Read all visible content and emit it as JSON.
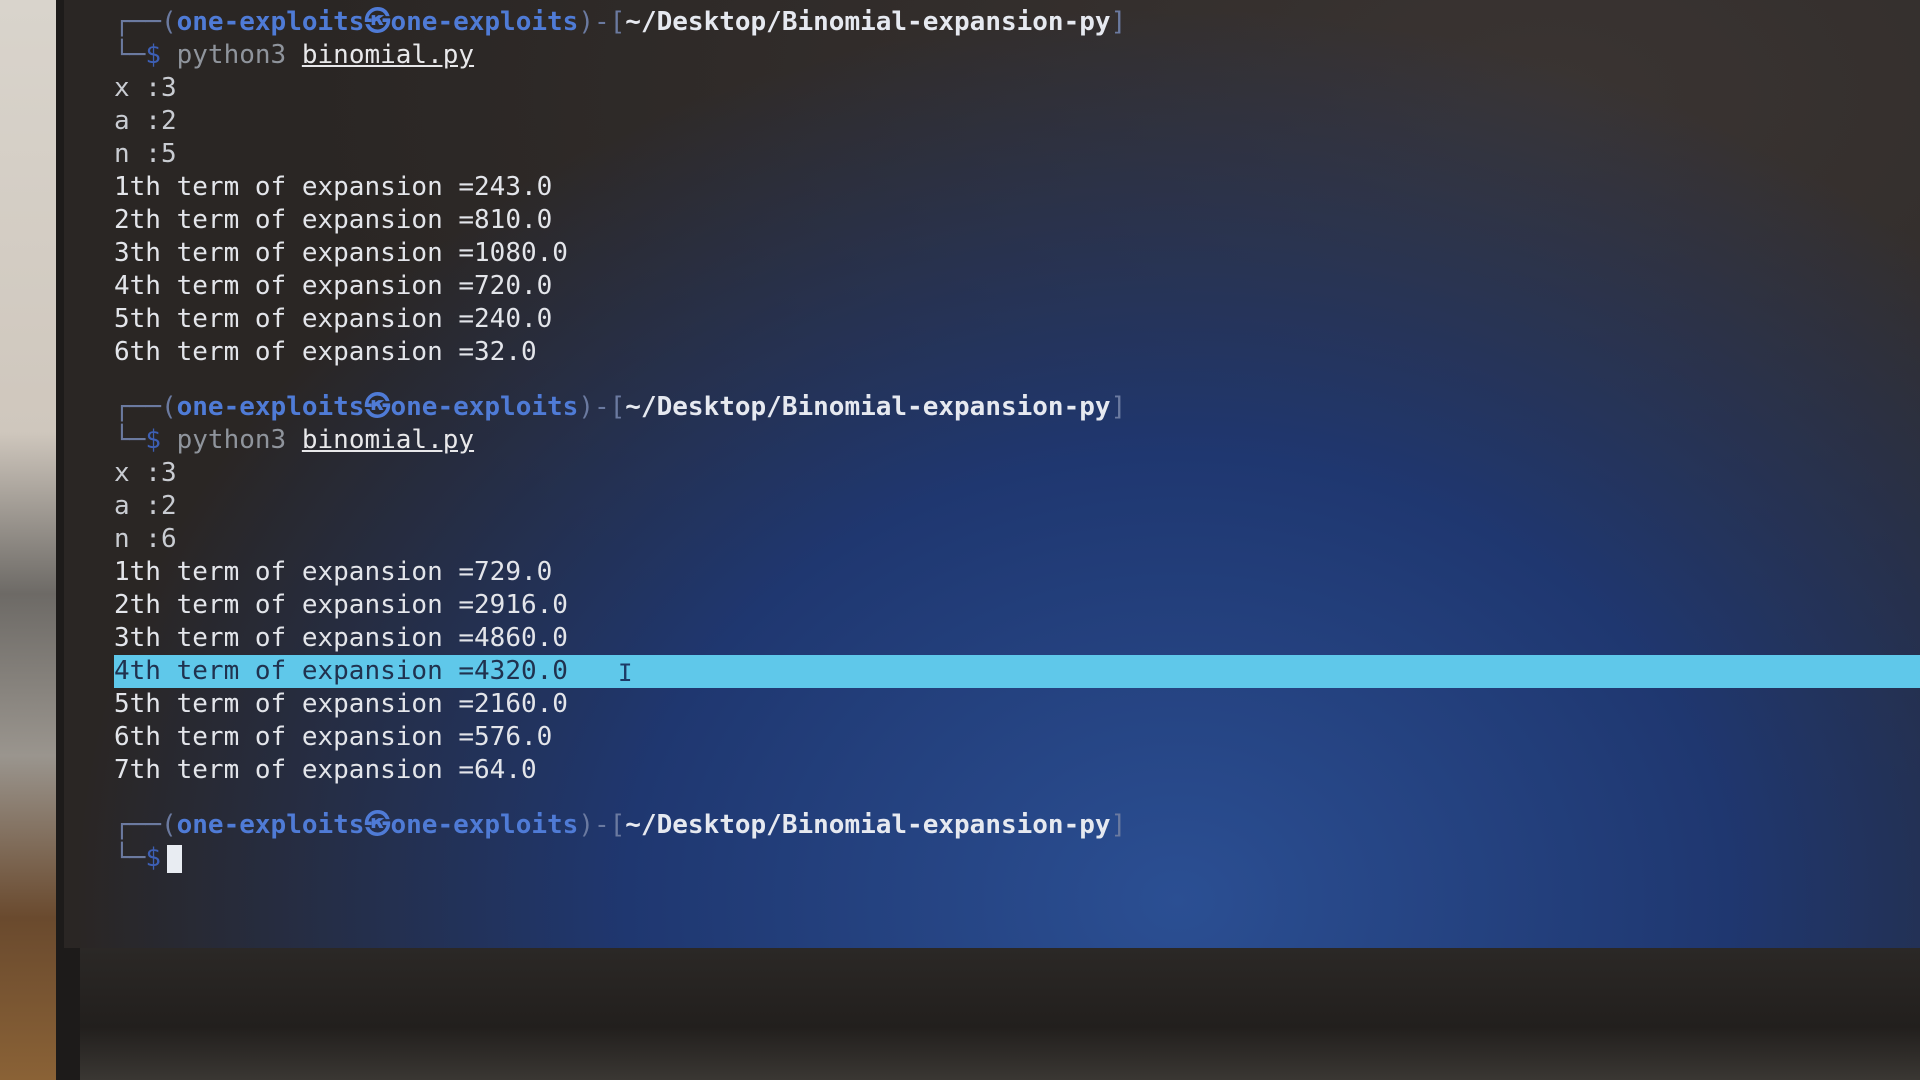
{
  "terminal": {
    "prompt": {
      "open": "┌──(",
      "user": "one-exploits",
      "at": "㉿",
      "host": "one-exploits",
      "mid": ")-[",
      "path": "~/Desktop/Binomial-expansion-py",
      "close": "]",
      "corner": "└─",
      "dollar": "$"
    },
    "runs": [
      {
        "command": "python3",
        "argument": "binomial.py",
        "inputs": [
          "x :3",
          "a :2",
          "n :5"
        ],
        "terms": [
          "1th term of expansion =243.0",
          "2th term of expansion =810.0",
          "3th term of expansion =1080.0",
          "4th term of expansion =720.0",
          "5th term of expansion =240.0",
          "6th term of expansion =32.0"
        ]
      },
      {
        "command": "python3",
        "argument": "binomial.py",
        "inputs": [
          "x :3",
          "a :2",
          "n :6"
        ],
        "terms": [
          "1th term of expansion =729.0",
          "2th term of expansion =2916.0",
          "3th term of expansion =4860.0",
          "4th term of expansion =4320.0",
          "5th term of expansion =2160.0",
          "6th term of expansion =576.0",
          "7th term of expansion =64.0"
        ]
      }
    ],
    "highlighted_line": "4th term of expansion =4320.0",
    "colors": {
      "user": "#4f7bd6",
      "highlight": "#5fc8ea",
      "background": "#232631"
    }
  }
}
